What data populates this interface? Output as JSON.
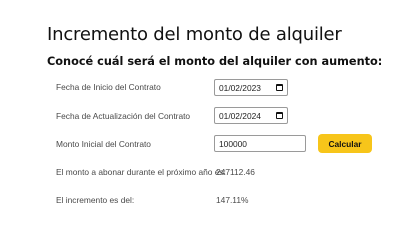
{
  "header": {
    "title": "Incremento del monto de alquiler",
    "subtitle": "Conocé cuál será el monto del alquiler con aumento:"
  },
  "form": {
    "start_date": {
      "label": "Fecha de Inicio del Contrato",
      "value": "01/02/2023"
    },
    "update_date": {
      "label": "Fecha de Actualización del Contrato",
      "value": "01/02/2024"
    },
    "initial_amount": {
      "label": "Monto Inicial del Contrato",
      "value": "100000"
    },
    "calculate_label": "Calcular"
  },
  "results": {
    "next_year_amount": {
      "label": "El monto a abonar durante el próximo año es:",
      "value": "247112.46"
    },
    "increment": {
      "label": "El incremento es del:",
      "value": "147.11%"
    }
  },
  "colors": {
    "accent": "#f7c51a"
  },
  "icons": {
    "date_picker": "calendar-icon"
  }
}
